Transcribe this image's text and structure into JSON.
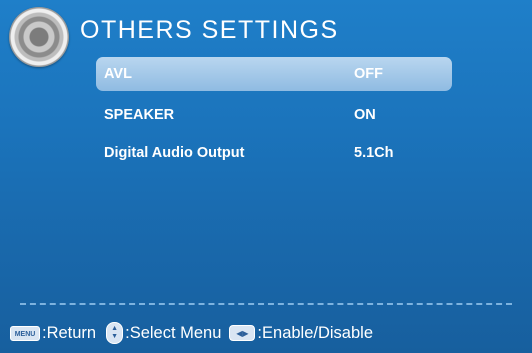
{
  "header": {
    "title": "OTHERS SETTINGS",
    "icon": "speaker-icon"
  },
  "menu": {
    "items": [
      {
        "label": "AVL",
        "value": "OFF",
        "selected": true
      },
      {
        "label": "SPEAKER",
        "value": "ON",
        "selected": false
      },
      {
        "label": "Digital Audio Output",
        "value": "5.1Ch",
        "selected": false
      }
    ]
  },
  "footer": {
    "menu_key": "MENU",
    "return_label": ":Return",
    "select_label": ":Select Menu",
    "enable_label": ":Enable/Disable"
  },
  "colors": {
    "background": "#1b74bc",
    "highlight": "#a9cceb",
    "text": "#ffffff"
  }
}
